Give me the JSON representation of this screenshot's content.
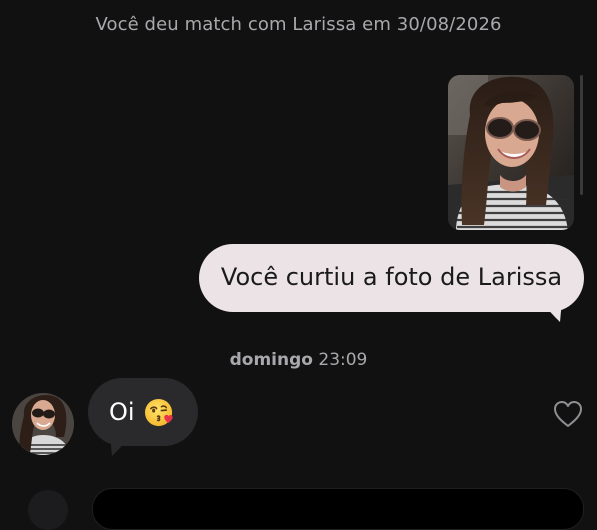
{
  "conversation": {
    "match_banner": "Você deu match com Larissa em 30/08/2026",
    "liked_photo_icon": "portrait-photo",
    "sent_message": "Você curtiu a foto de Larissa",
    "timestamp_day": "domingo",
    "timestamp_time": "23:09",
    "received_message": "Oi",
    "received_emoji_icon": "face-blowing-kiss-emoji",
    "like_icon": "heart-outline-icon"
  },
  "colors": {
    "background": "#111111",
    "sent_bubble": "#ebe3e6",
    "received_bubble": "#2a2a2c",
    "muted_text": "#a9a9ad"
  }
}
